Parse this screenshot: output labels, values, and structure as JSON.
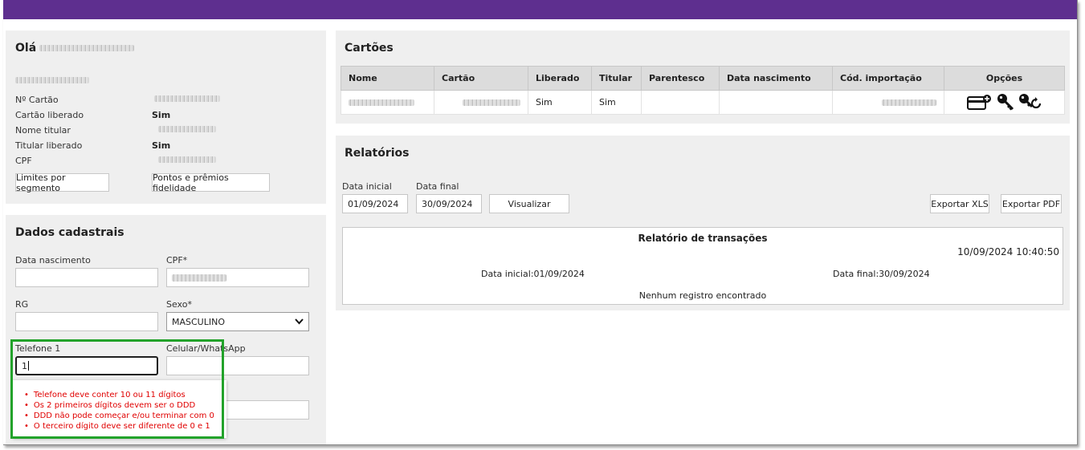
{
  "profile": {
    "greeting": "Olá",
    "fields": [
      {
        "label": "Nº Cartão"
      },
      {
        "label": "Cartão liberado",
        "value": "Sim"
      },
      {
        "label": "Nome titular"
      },
      {
        "label": "Titular liberado",
        "value": "Sim"
      },
      {
        "label": "CPF"
      }
    ],
    "btn_limits": "Limites por segmento",
    "btn_points": "Pontos e prêmios fidelidade"
  },
  "register": {
    "title": "Dados cadastrais",
    "birth_label": "Data nascimento",
    "cpf_label": "CPF*",
    "rg_label": "RG",
    "sex_label": "Sexo*",
    "sex_value": "MASCULINO",
    "phone1_label": "Telefone 1",
    "phone1_value": "1",
    "cell_label": "Celular/WhatsApp",
    "errors": [
      "Telefone deve conter 10 ou 11 dígitos",
      "Os 2 primeiros dígitos devem ser o DDD",
      "DDD não pode começar e/ou terminar com 0",
      "O terceiro dígito deve ser diferente de 0 e 1"
    ]
  },
  "cards": {
    "title": "Cartões",
    "columns": [
      "Nome",
      "Cartão",
      "Liberado",
      "Titular",
      "Parentesco",
      "Data nascimento",
      "Cód. importação",
      "Opções"
    ],
    "row": {
      "liberado": "Sim",
      "titular": "Sim"
    }
  },
  "reports": {
    "title": "Relatórios",
    "start_label": "Data inicial",
    "start_value": "01/09/2024",
    "end_label": "Data final",
    "end_value": "30/09/2024",
    "view_button": "Visualizar",
    "export_xls": "Exportar XLS",
    "export_pdf": "Exportar PDF",
    "report_title": "Relatório de transações",
    "timestamp": "10/09/2024 10:40:50",
    "range_start": "Data inicial:01/09/2024",
    "range_end": "Data final:30/09/2024",
    "empty": "Nenhum registro encontrado"
  },
  "colors": {
    "topbar": "#5e2f8f",
    "highlight": "#22a22a",
    "error": "#e00000"
  },
  "icons": [
    "add-card-icon",
    "key-icon",
    "key-reset-icon",
    "chevron-down-icon"
  ]
}
